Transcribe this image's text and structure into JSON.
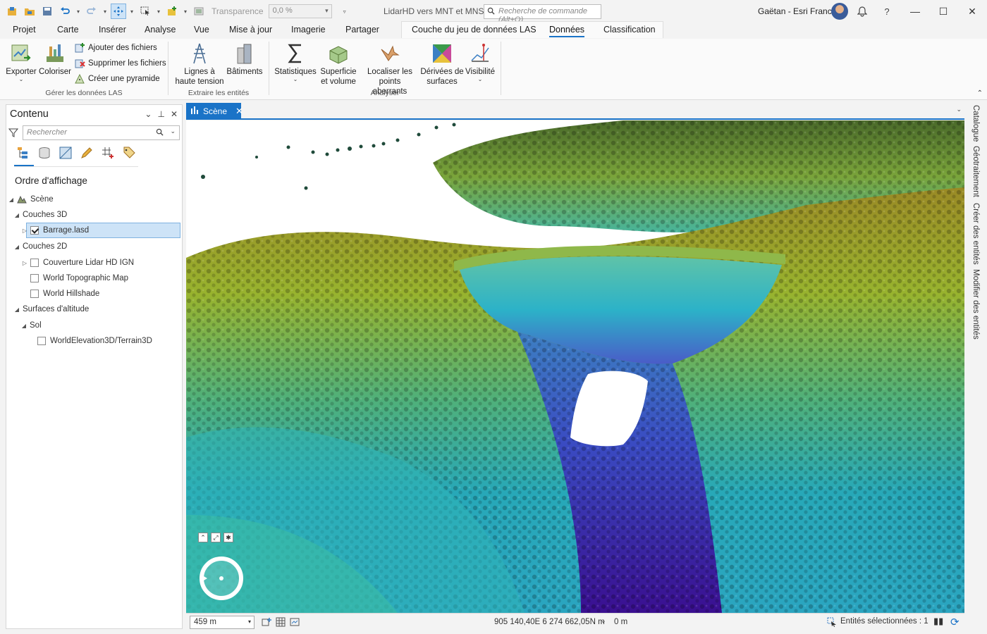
{
  "titlebar": {
    "transparency_label": "Transparence",
    "transparency_value": "0,0 %",
    "app_title": "LidarHD vers MNT et MNS",
    "search_placeholder": "Recherche de commande (Alt+Q)",
    "user": "Gaëtan - Esri France"
  },
  "tabs": [
    "Projet",
    "Carte",
    "Insérer",
    "Analyse",
    "Vue",
    "Mise à jour",
    "Imagerie",
    "Partager",
    "Couche du jeu de données LAS",
    "Données",
    "Classification"
  ],
  "ribbon": {
    "export": "Exporter",
    "colorize": "Coloriser",
    "add_files": "Ajouter des fichiers",
    "remove_files": "Supprimer les fichiers",
    "create_pyramid": "Créer une pyramide",
    "group_manage": "Gérer les données LAS",
    "power_lines_1": "Lignes à",
    "power_lines_2": "haute tension",
    "buildings": "Bâtiments",
    "group_extract": "Extraire les entités",
    "statistics": "Statistiques",
    "area_volume_1": "Superficie",
    "area_volume_2": "et volume",
    "outliers_1": "Localiser les",
    "outliers_2": "points aberrants",
    "derived_1": "Dérivées de",
    "derived_2": "surfaces",
    "visibility": "Visibilité",
    "group_analyze": "Analyser"
  },
  "contents": {
    "title": "Contenu",
    "search_placeholder": "Rechercher",
    "section": "Ordre d'affichage",
    "scene": "Scène",
    "group_3d": "Couches 3D",
    "layer_barrage": "Barrage.lasd",
    "group_2d": "Couches 2D",
    "layer_lidar": "Couverture Lidar HD IGN",
    "layer_topo": "World Topographic Map",
    "layer_hillshade": "World Hillshade",
    "group_elev": "Surfaces d'altitude",
    "ground": "Sol",
    "terrain": "WorldElevation3D/Terrain3D"
  },
  "scene": {
    "tab_label": "Scène",
    "scale": "459 m",
    "coordinates": "905 140,40E 6 274 662,05N m",
    "elevation": "0 m",
    "selected": "Entités sélectionnées : 1"
  },
  "dock": [
    "Catalogue",
    "Géotraitement",
    "Créer des entités",
    "Modifier des entités"
  ],
  "colors": {
    "accent": "#1a73c7",
    "selection": "#cde3f7"
  }
}
